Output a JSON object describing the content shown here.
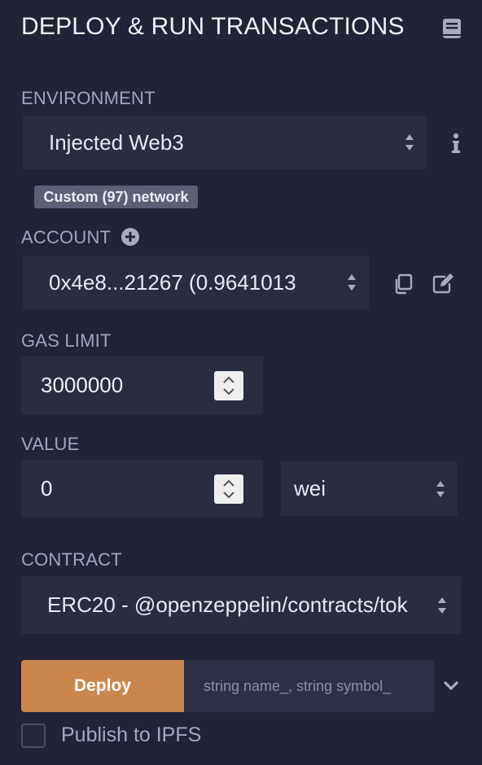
{
  "header": {
    "title": "DEPLOY & RUN TRANSACTIONS",
    "doc_icon": "book-icon"
  },
  "environment": {
    "label": "ENVIRONMENT",
    "selected": "Injected Web3",
    "network_badge": "Custom (97) network",
    "info_icon": "info-icon"
  },
  "account": {
    "label": "ACCOUNT",
    "selected": "0x4e8...21267 (0.9641013",
    "add_icon": "plus-circle-icon",
    "copy_icon": "copy-icon",
    "edit_icon": "edit-icon"
  },
  "gas_limit": {
    "label": "GAS LIMIT",
    "value": "3000000"
  },
  "value": {
    "label": "VALUE",
    "amount": "0",
    "unit": "wei"
  },
  "contract": {
    "label": "CONTRACT",
    "selected": "ERC20 - @openzeppelin/contracts/tok"
  },
  "deploy": {
    "button_label": "Deploy",
    "params_placeholder": "string name_, string symbol_",
    "expand_icon": "chevron-down-icon"
  },
  "publish": {
    "label": "Publish to IPFS",
    "checked": false
  },
  "colors": {
    "background": "#222336",
    "field": "#2a2c3f",
    "deploy_accent": "#c9874e",
    "label": "#a2a3bd"
  }
}
